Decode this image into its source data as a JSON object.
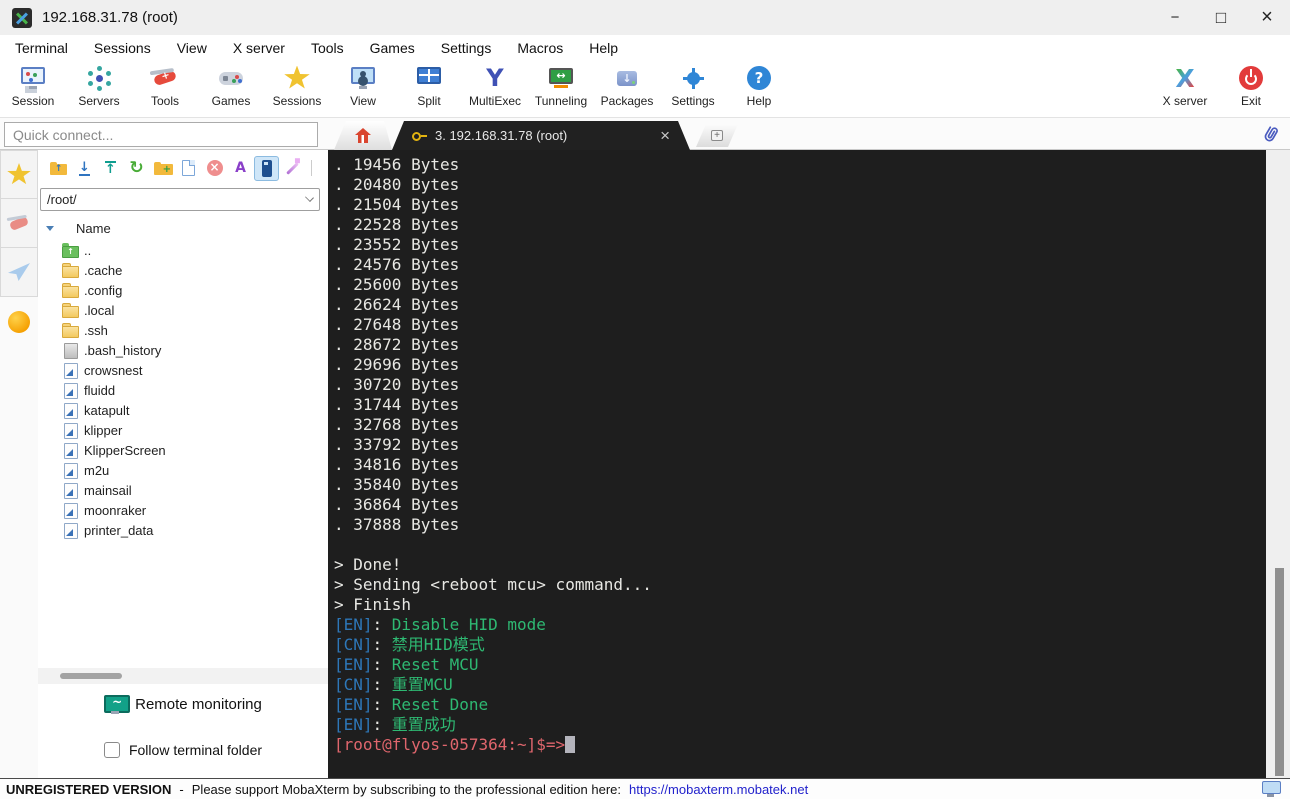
{
  "window": {
    "title": "192.168.31.78 (root)"
  },
  "menu": {
    "items": [
      "Terminal",
      "Sessions",
      "View",
      "X server",
      "Tools",
      "Games",
      "Settings",
      "Macros",
      "Help"
    ]
  },
  "toolbar": {
    "items": [
      {
        "icon": "session",
        "label": "Session"
      },
      {
        "icon": "servers",
        "label": "Servers"
      },
      {
        "icon": "tools",
        "label": "Tools"
      },
      {
        "icon": "games",
        "label": "Games"
      },
      {
        "icon": "star",
        "label": "Sessions"
      },
      {
        "icon": "view",
        "label": "View"
      },
      {
        "icon": "split",
        "label": "Split"
      },
      {
        "icon": "multiexec",
        "label": "MultiExec"
      },
      {
        "icon": "tunneling",
        "label": "Tunneling"
      },
      {
        "icon": "packages",
        "label": "Packages"
      },
      {
        "icon": "settings",
        "label": "Settings"
      },
      {
        "icon": "help",
        "label": "Help"
      }
    ],
    "right_items": [
      {
        "icon": "xserver",
        "label": "X server"
      },
      {
        "icon": "exit",
        "label": "Exit"
      }
    ]
  },
  "quick_connect": {
    "placeholder": "Quick connect..."
  },
  "tabs": {
    "home_icon": "home-icon",
    "active": {
      "key_icon": "key-icon",
      "label": "3. 192.168.31.78 (root)",
      "close_icon": "close-icon"
    },
    "new_tab_icon": "new-tab-icon",
    "attachments_icon": "paperclip-icon"
  },
  "sidebar": {
    "strip_icons": [
      "star",
      "knife",
      "plane",
      "globe"
    ],
    "mini_toolbar_icons": [
      "folder-up",
      "download",
      "upload",
      "refresh",
      "new-folder",
      "new-file",
      "delete",
      "rename",
      "sync",
      "wand"
    ],
    "selected_mini_icon": "sync",
    "path": "/root/",
    "list_header": "Name",
    "files": [
      {
        "name": "..",
        "icon": "folder-up"
      },
      {
        "name": ".cache",
        "icon": "folder"
      },
      {
        "name": ".config",
        "icon": "folder"
      },
      {
        "name": ".local",
        "icon": "folder"
      },
      {
        "name": ".ssh",
        "icon": "folder"
      },
      {
        "name": ".bash_history",
        "icon": "file"
      },
      {
        "name": "crowsnest",
        "icon": "symlink"
      },
      {
        "name": "fluidd",
        "icon": "symlink"
      },
      {
        "name": "katapult",
        "icon": "symlink"
      },
      {
        "name": "klipper",
        "icon": "symlink"
      },
      {
        "name": "KlipperScreen",
        "icon": "symlink"
      },
      {
        "name": "m2u",
        "icon": "symlink"
      },
      {
        "name": "mainsail",
        "icon": "symlink"
      },
      {
        "name": "moonraker",
        "icon": "symlink"
      },
      {
        "name": "printer_data",
        "icon": "symlink"
      }
    ],
    "remote_monitoring_label": "Remote monitoring",
    "remote_monitoring_icon": "monitor-graph-icon",
    "follow_checkbox_label": "Follow terminal folder",
    "follow_checkbox_checked": false
  },
  "terminal": {
    "background": "#1e1e1e",
    "colors": {
      "white": "#e8e8e4",
      "blue": "#2d77b8",
      "green": "#2eb872",
      "red": "#e0666d",
      "cursor": "#b4b4bc"
    },
    "lines": [
      [
        [
          "white",
          ". 19456 Bytes"
        ]
      ],
      [
        [
          "white",
          ". 20480 Bytes"
        ]
      ],
      [
        [
          "white",
          ". 21504 Bytes"
        ]
      ],
      [
        [
          "white",
          ". 22528 Bytes"
        ]
      ],
      [
        [
          "white",
          ". 23552 Bytes"
        ]
      ],
      [
        [
          "white",
          ". 24576 Bytes"
        ]
      ],
      [
        [
          "white",
          ". 25600 Bytes"
        ]
      ],
      [
        [
          "white",
          ". 26624 Bytes"
        ]
      ],
      [
        [
          "white",
          ". 27648 Bytes"
        ]
      ],
      [
        [
          "white",
          ". 28672 Bytes"
        ]
      ],
      [
        [
          "white",
          ". 29696 Bytes"
        ]
      ],
      [
        [
          "white",
          ". 30720 Bytes"
        ]
      ],
      [
        [
          "white",
          ". 31744 Bytes"
        ]
      ],
      [
        [
          "white",
          ". 32768 Bytes"
        ]
      ],
      [
        [
          "white",
          ". 33792 Bytes"
        ]
      ],
      [
        [
          "white",
          ". 34816 Bytes"
        ]
      ],
      [
        [
          "white",
          ". 35840 Bytes"
        ]
      ],
      [
        [
          "white",
          ". 36864 Bytes"
        ]
      ],
      [
        [
          "white",
          ". 37888 Bytes"
        ]
      ],
      [],
      [
        [
          "white",
          "> Done!"
        ]
      ],
      [
        [
          "white",
          "> Sending <reboot mcu> command..."
        ]
      ],
      [
        [
          "white",
          "> Finish"
        ]
      ],
      [
        [
          "blue",
          "[EN]"
        ],
        [
          "white",
          ": "
        ],
        [
          "green",
          "Disable HID mode"
        ]
      ],
      [
        [
          "blue",
          "[CN]"
        ],
        [
          "white",
          ": "
        ],
        [
          "green",
          "禁用HID模式"
        ]
      ],
      [
        [
          "blue",
          "[EN]"
        ],
        [
          "white",
          ": "
        ],
        [
          "green",
          "Reset MCU"
        ]
      ],
      [
        [
          "blue",
          "[CN]"
        ],
        [
          "white",
          ": "
        ],
        [
          "green",
          "重置MCU"
        ]
      ],
      [
        [
          "blue",
          "[EN]"
        ],
        [
          "white",
          ": "
        ],
        [
          "green",
          "Reset Done"
        ]
      ],
      [
        [
          "blue",
          "[EN]"
        ],
        [
          "white",
          ": "
        ],
        [
          "green",
          "重置成功"
        ]
      ],
      [
        [
          "red",
          "[root@flyos-057364:~]$=>"
        ],
        [
          "cursor",
          ""
        ]
      ]
    ]
  },
  "statusbar": {
    "version": "UNREGISTERED VERSION",
    "dash": "-",
    "message": "Please support MobaXterm by subscribing to the professional edition here:",
    "link": "https://mobaxterm.mobatek.net",
    "monitor_icon": "monitor-icon"
  }
}
